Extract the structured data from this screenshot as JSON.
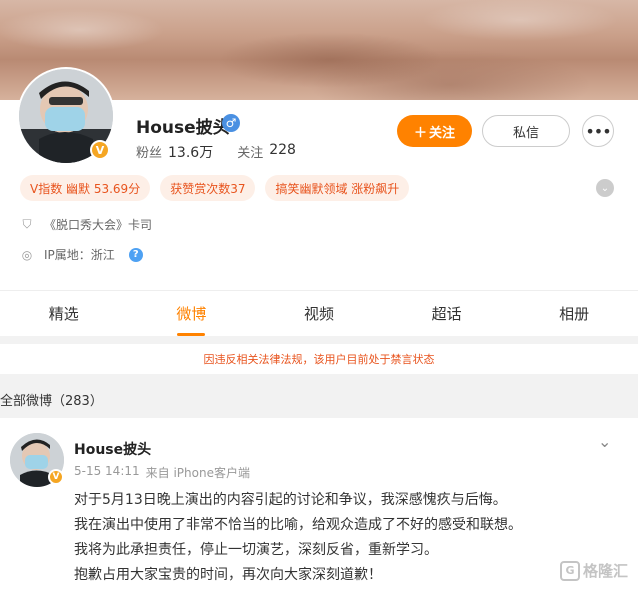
{
  "profile": {
    "name": "House披头",
    "fans_label": "粉丝",
    "fans_value": "13.6万",
    "following_label": "关注",
    "following_value": "228",
    "follow_button": "关注",
    "message_button": "私信",
    "more_button": "•••",
    "tags": [
      "V指数 幽默 53.69分",
      "获赞赏次数37",
      "搞笑幽默领域 涨粉飙升"
    ],
    "info_work": "《脱口秀大会》卡司",
    "info_ip": "IP属地：浙江"
  },
  "tabs": [
    "精选",
    "微博",
    "视频",
    "超话",
    "相册"
  ],
  "active_tab_index": 1,
  "notice": "因违反相关法律法规，该用户目前处于禁言状态",
  "section_title": "全部微博（283）",
  "post": {
    "author": "House披头",
    "date": "5-15 14:11",
    "source": "来自 iPhone客户端",
    "lines": [
      "对于5月13日晚上演出的内容引起的讨论和争议，我深感愧疚与后悔。",
      "我在演出中使用了非常不恰当的比喻，给观众造成了不好的感受和联想。",
      "我将为此承担责任，停止一切演艺，深刻反省，重新学习。",
      "抱歉占用大家宝贵的时间，再次向大家深刻道歉！"
    ]
  },
  "watermark": "格隆汇",
  "colors": {
    "accent": "#ff8200",
    "tag_text": "#e8541e",
    "tag_bg": "#fdefe7",
    "verified": "#f5a623",
    "gender": "#4a90e2"
  }
}
